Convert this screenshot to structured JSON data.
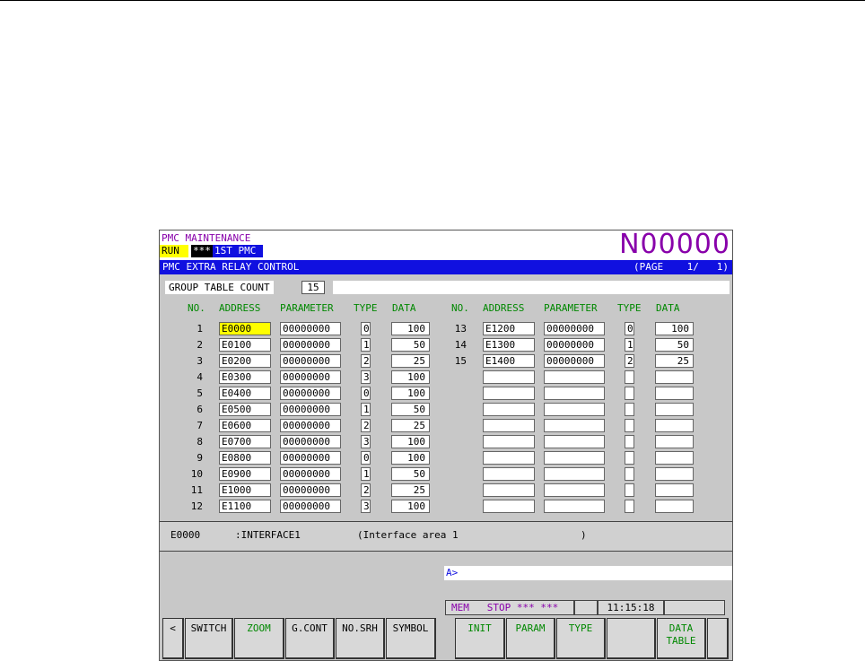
{
  "header": {
    "title": "PMC MAINTENANCE",
    "run_label": "RUN",
    "stars": "***",
    "pmc_label": "1ST PMC",
    "program": "N00000"
  },
  "bar": {
    "title": "PMC EXTRA RELAY CONTROL",
    "page": "(PAGE    1/   1)"
  },
  "group": {
    "label": "GROUP TABLE COUNT",
    "value": "15"
  },
  "columns": {
    "no": "NO.",
    "address": "ADDRESS",
    "parameter": "PARAMETER",
    "type": "TYPE",
    "data": "DATA"
  },
  "rows": [
    {
      "no": "1",
      "address": "E0000",
      "parameter": "00000000",
      "type": "0",
      "data": "100"
    },
    {
      "no": "2",
      "address": "E0100",
      "parameter": "00000000",
      "type": "1",
      "data": "50"
    },
    {
      "no": "3",
      "address": "E0200",
      "parameter": "00000000",
      "type": "2",
      "data": "25"
    },
    {
      "no": "4",
      "address": "E0300",
      "parameter": "00000000",
      "type": "3",
      "data": "100"
    },
    {
      "no": "5",
      "address": "E0400",
      "parameter": "00000000",
      "type": "0",
      "data": "100"
    },
    {
      "no": "6",
      "address": "E0500",
      "parameter": "00000000",
      "type": "1",
      "data": "50"
    },
    {
      "no": "7",
      "address": "E0600",
      "parameter": "00000000",
      "type": "2",
      "data": "25"
    },
    {
      "no": "8",
      "address": "E0700",
      "parameter": "00000000",
      "type": "3",
      "data": "100"
    },
    {
      "no": "9",
      "address": "E0800",
      "parameter": "00000000",
      "type": "0",
      "data": "100"
    },
    {
      "no": "10",
      "address": "E0900",
      "parameter": "00000000",
      "type": "1",
      "data": "50"
    },
    {
      "no": "11",
      "address": "E1000",
      "parameter": "00000000",
      "type": "2",
      "data": "25"
    },
    {
      "no": "12",
      "address": "E1100",
      "parameter": "00000000",
      "type": "3",
      "data": "100"
    },
    {
      "no": "13",
      "address": "E1200",
      "parameter": "00000000",
      "type": "0",
      "data": "100"
    },
    {
      "no": "14",
      "address": "E1300",
      "parameter": "00000000",
      "type": "1",
      "data": "50"
    },
    {
      "no": "15",
      "address": "E1400",
      "parameter": "00000000",
      "type": "2",
      "data": "25"
    }
  ],
  "info": {
    "address": "E0000",
    "symbol": ":INTERFACE1",
    "comment": "(Interface area 1",
    "close": ")"
  },
  "prompt": "A>",
  "status": {
    "mode": "MEM",
    "state": "STOP",
    "stars": "*** ***",
    "time": "11:15:18"
  },
  "softkeys": {
    "left": "<",
    "switch": "SWITCH",
    "zoom": "ZOOM",
    "gcont": "G.CONT",
    "nosrh": "NO.SRH",
    "symbol": "SYMBOL",
    "init": "INIT",
    "param": "PARAM",
    "type": "TYPE",
    "data_table_1": "DATA",
    "data_table_2": "TABLE"
  },
  "colors": {
    "title": "#8800aa",
    "bar": "#1010e0",
    "header_text": "#008800",
    "selected": "#ffff00"
  }
}
